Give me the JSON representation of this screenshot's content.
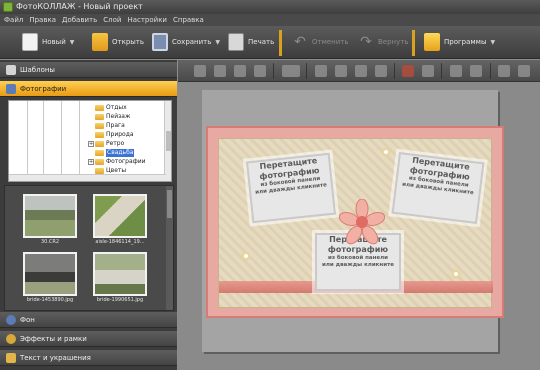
{
  "window": {
    "title": "ФотоКОЛЛАЖ - Новый проект"
  },
  "menu": [
    "Файл",
    "Правка",
    "Добавить",
    "Слой",
    "Настройки",
    "Справка"
  ],
  "toolbar": {
    "new": "Новый",
    "open": "Открыть",
    "save": "Сохранить",
    "print": "Печать",
    "undo": "Отменить",
    "redo": "Вернуть",
    "programs": "Программы"
  },
  "left": {
    "templates": "Шаблоны",
    "photos": "Фотографии",
    "tree": [
      {
        "label": "Отдых",
        "selected": false,
        "plus": false
      },
      {
        "label": "Пейзаж",
        "selected": false,
        "plus": false
      },
      {
        "label": "Прага",
        "selected": false,
        "plus": false
      },
      {
        "label": "Природа",
        "selected": false,
        "plus": false
      },
      {
        "label": "Ретро",
        "selected": false,
        "plus": true
      },
      {
        "label": "Свадьба",
        "selected": true,
        "plus": false
      },
      {
        "label": "Фотографии",
        "selected": false,
        "plus": true
      },
      {
        "label": "Цветы",
        "selected": false,
        "plus": false
      }
    ],
    "thumbnails": [
      {
        "caption": "30.CR2"
      },
      {
        "caption": "aisle-1846114_19..."
      },
      {
        "caption": "bride-1453890.jpg"
      },
      {
        "caption": "bride-1990651.jpg"
      }
    ],
    "bottom_sections": [
      "Фон",
      "Эффекты и рамки",
      "Текст и украшения"
    ]
  },
  "collage": {
    "slot_line1": "Перетащите",
    "slot_line2": "фотографию",
    "slot_line3": "из боковой панели",
    "slot_line4": "или дважды кликните"
  }
}
